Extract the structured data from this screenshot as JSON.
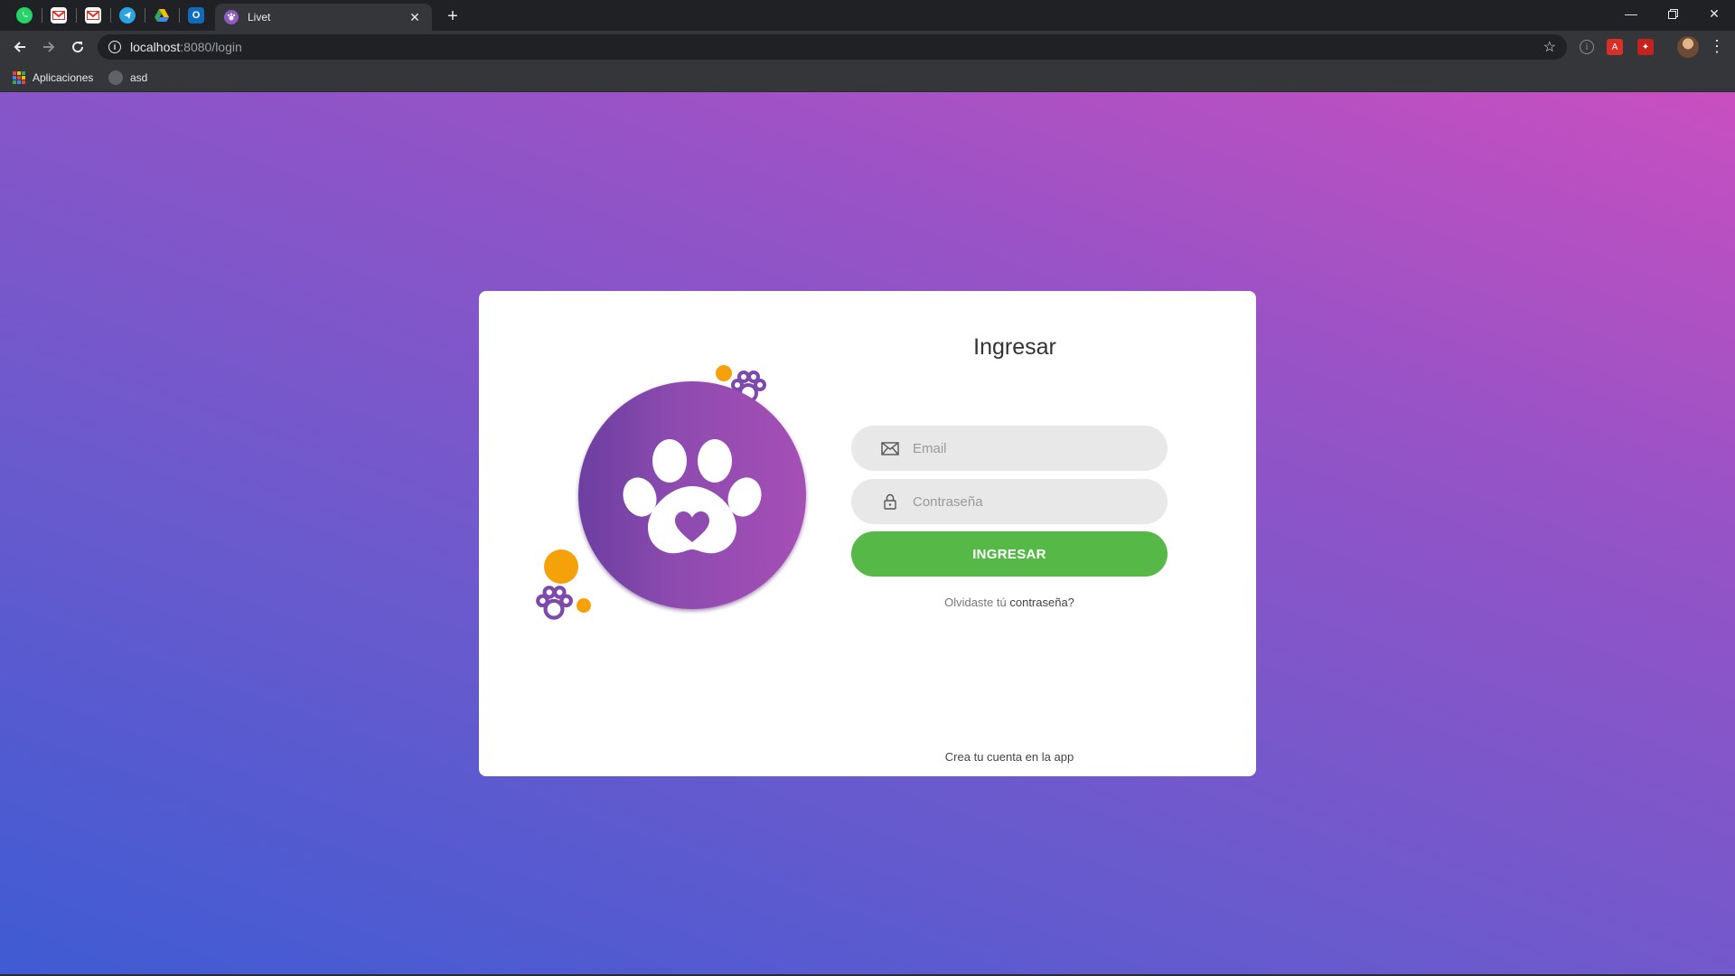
{
  "browser": {
    "tab_title": "Livet",
    "address_host": "localhost",
    "address_path": ":8080/login",
    "bookmarks": [
      {
        "label": "Aplicaciones",
        "icon": "apps-icon"
      },
      {
        "label": "asd",
        "icon": "bookmark-favicon-icon"
      }
    ],
    "pinned_tabs": [
      "whatsapp-icon",
      "gmail-icon",
      "gmail-icon",
      "telegram-icon",
      "google-drive-icon",
      "outlook-icon"
    ]
  },
  "login": {
    "title": "Ingresar",
    "email_placeholder": "Email",
    "password_placeholder": "Contraseña",
    "submit_label": "INGRESAR",
    "forgot_prefix": "Olvidaste tú",
    "forgot_link": "contraseña?",
    "create_account": "Crea tu cuenta en la app"
  },
  "colors": {
    "gradient_start": "#3f5bd3",
    "gradient_end": "#c94fc0",
    "logo_purple": "#8f4bb0",
    "accent_orange": "#f5a10a",
    "button_green": "#55b847"
  }
}
